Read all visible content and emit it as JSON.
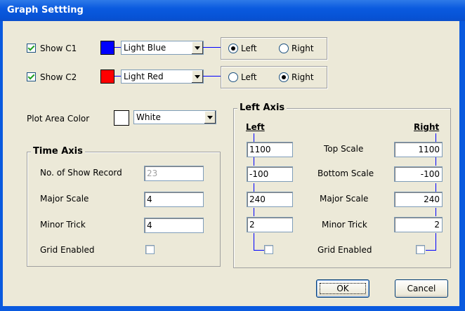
{
  "window": {
    "title": "Graph Settting"
  },
  "series": [
    {
      "show_label": "Show  C1",
      "checked": true,
      "color_hex": "#0000FF",
      "color_name": "Light Blue",
      "axis_left": "Left",
      "axis_right": "Right",
      "axis_selected": "Left"
    },
    {
      "show_label": "Show  C2",
      "checked": true,
      "color_hex": "#FF0000",
      "color_name": "Light Red",
      "axis_left": "Left",
      "axis_right": "Right",
      "axis_selected": "Right"
    }
  ],
  "plot_area": {
    "label": "Plot Area Color",
    "color_hex": "#FFFFFF",
    "color_name": "White"
  },
  "time_axis": {
    "title": "Time Axis",
    "rows": [
      {
        "label": "No. of Show Record",
        "value": "23",
        "enabled": false
      },
      {
        "label": "Major Scale",
        "value": "4",
        "enabled": true
      },
      {
        "label": "Minor Trick",
        "value": "4",
        "enabled": true
      }
    ],
    "grid_label": "Grid Enabled",
    "grid_checked": false
  },
  "left_axis": {
    "title": "Left Axis",
    "col_left": "Left",
    "col_right": "Right",
    "rows": [
      {
        "label": "Top Scale",
        "left": "1100",
        "right": "1100"
      },
      {
        "label": "Bottom Scale",
        "left": "-100",
        "right": "-100"
      },
      {
        "label": "Major Scale",
        "left": "240",
        "right": "240"
      },
      {
        "label": "Minor Trick",
        "left": "2",
        "right": "2"
      }
    ],
    "grid_label": "Grid Enabled",
    "grid_left": false,
    "grid_right": false
  },
  "buttons": {
    "ok": "OK",
    "cancel": "Cancel"
  }
}
